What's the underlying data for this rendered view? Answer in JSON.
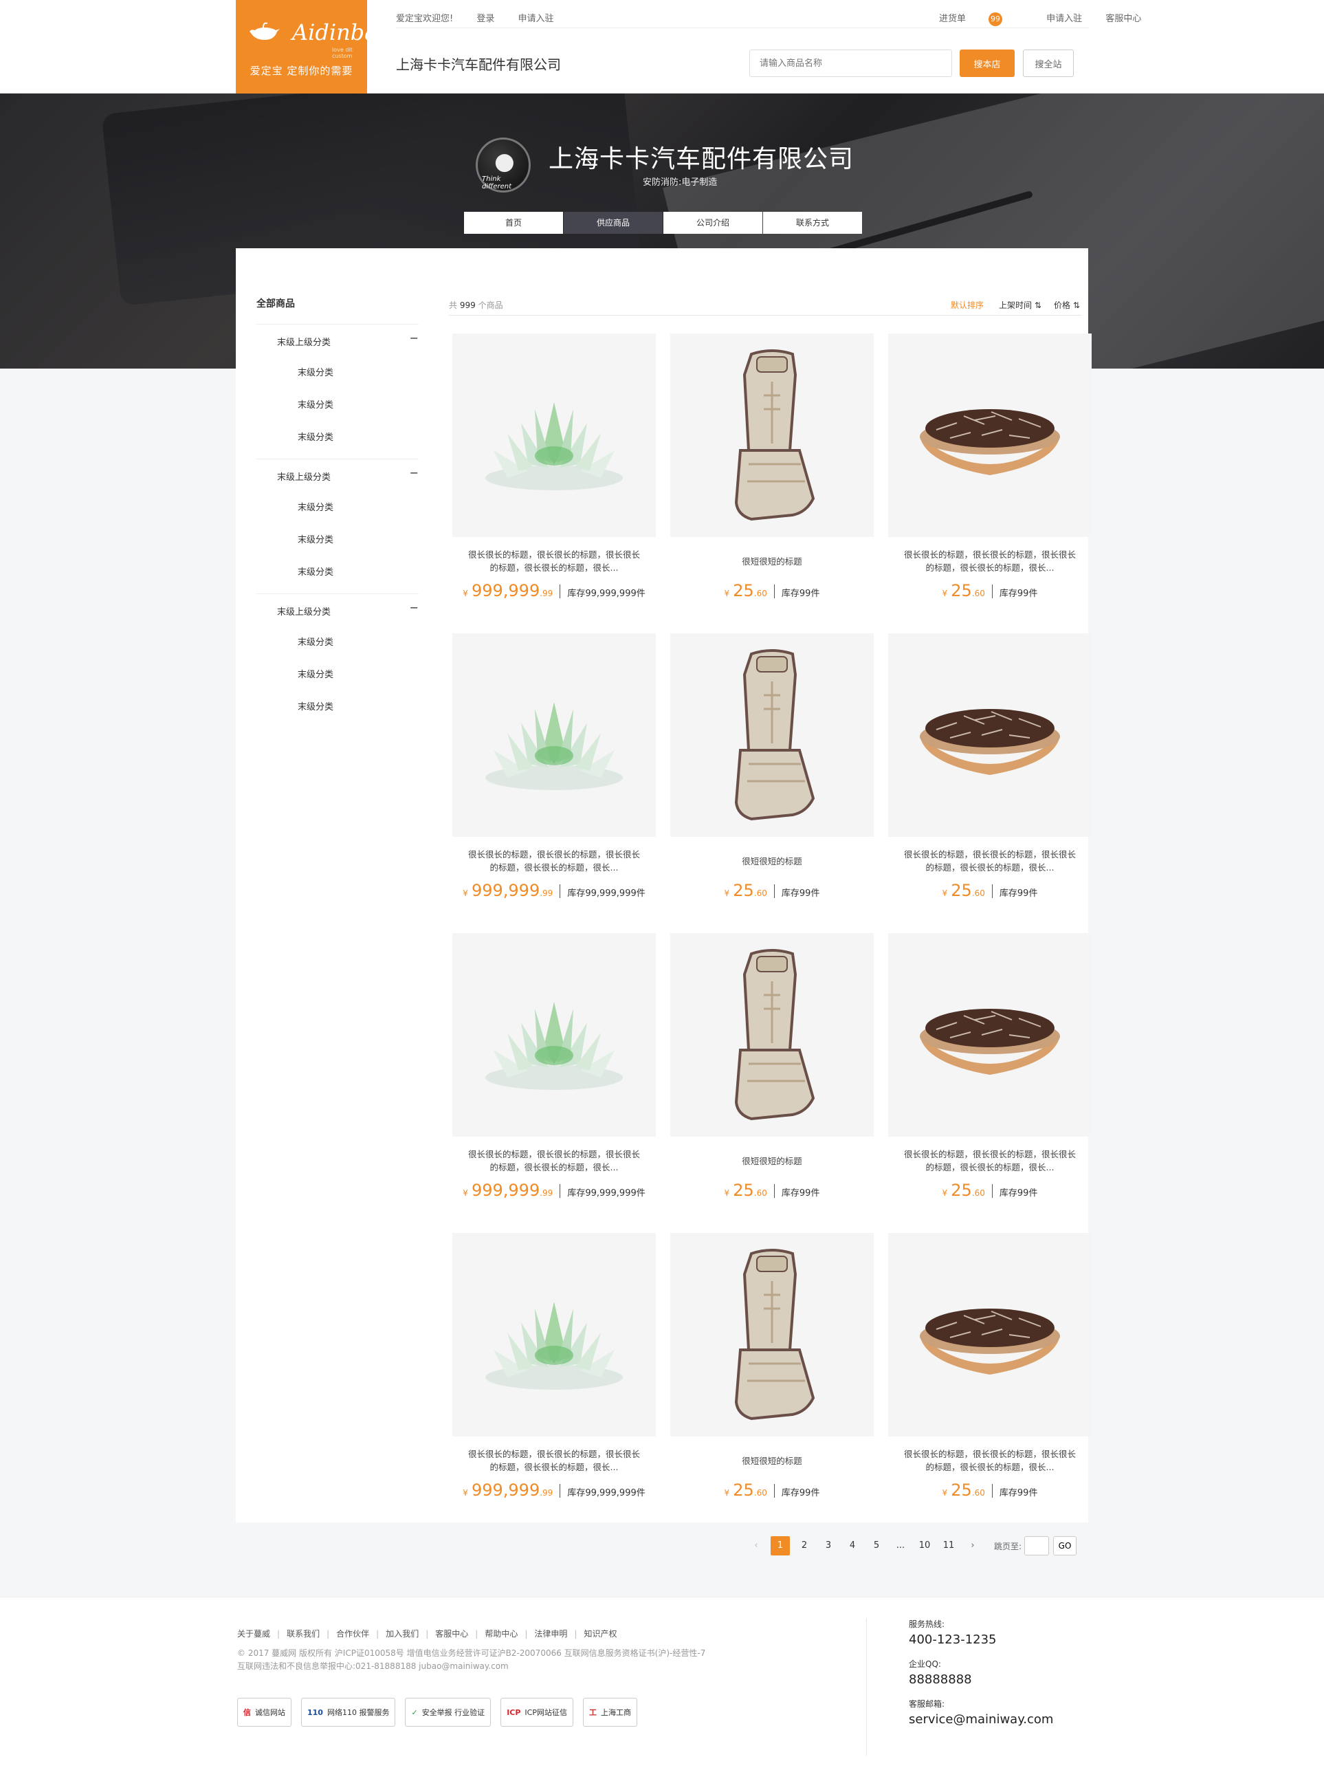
{
  "logo": {
    "brand": "Aidinbao",
    "tagline": "love dit custom",
    "slogan": "爱定宝 定制你的需要"
  },
  "topbar": {
    "welcome": "爱定宝欢迎您!",
    "login": "登录",
    "apply": "申请入驻",
    "cart_label": "进货单",
    "cart_count": "99",
    "apply_right": "申请入驻",
    "service": "客服中心"
  },
  "header": {
    "shop_name": "上海卡卡汽车配件有限公司",
    "search_placeholder": "请输入商品名称",
    "search_shop": "搜本店",
    "search_all": "搜全站"
  },
  "hero": {
    "title": "上海卡卡汽车配件有限公司",
    "subtitle": "安防消防:电子制造",
    "avatar_text": "Think different",
    "tabs": [
      {
        "label": "首页"
      },
      {
        "label": "供应商品"
      },
      {
        "label": "公司介绍"
      },
      {
        "label": "联系方式"
      }
    ],
    "active_tab": 1
  },
  "sidebar": {
    "title": "全部商品",
    "groups": [
      {
        "label": "末级上级分类",
        "toggle": "−",
        "leaves": [
          "末级分类",
          "末级分类",
          "末级分类"
        ]
      },
      {
        "label": "末级上级分类",
        "toggle": "−",
        "leaves": [
          "末级分类",
          "末级分类",
          "末级分类"
        ]
      },
      {
        "label": "末级上级分类",
        "toggle": "−",
        "leaves": [
          "末级分类",
          "末级分类",
          "末级分类"
        ]
      }
    ]
  },
  "toolbar": {
    "total_prefix": "共",
    "total_count": "999",
    "total_suffix": "个商品",
    "sort_default": "默认排序",
    "sort_time": "上架时间 ⇅",
    "sort_price": "价格 ⇅"
  },
  "products": [
    {
      "type": "lotus",
      "title": "很长很长的标题，很长很长的标题，很长很长的标题，很长很长的标题，很长...",
      "currency": "¥",
      "price_int": "999,999",
      "price_dec": ".99",
      "stock": "库存99,999,999件"
    },
    {
      "type": "seat",
      "title": "很短很短的标题",
      "currency": "¥",
      "price_int": "25",
      "price_dec": ".60",
      "stock": "库存99件"
    },
    {
      "type": "seeds",
      "title": "很长很长的标题，很长很长的标题，很长很长的标题，很长很长的标题，很长...",
      "currency": "¥",
      "price_int": "25",
      "price_dec": ".60",
      "stock": "库存99件"
    },
    {
      "type": "lotus",
      "title": "很长很长的标题，很长很长的标题，很长很长的标题，很长很长的标题，很长...",
      "currency": "¥",
      "price_int": "999,999",
      "price_dec": ".99",
      "stock": "库存99,999,999件"
    },
    {
      "type": "seat",
      "title": "很短很短的标题",
      "currency": "¥",
      "price_int": "25",
      "price_dec": ".60",
      "stock": "库存99件"
    },
    {
      "type": "seeds",
      "title": "很长很长的标题，很长很长的标题，很长很长的标题，很长很长的标题，很长...",
      "currency": "¥",
      "price_int": "25",
      "price_dec": ".60",
      "stock": "库存99件"
    },
    {
      "type": "lotus",
      "title": "很长很长的标题，很长很长的标题，很长很长的标题，很长很长的标题，很长...",
      "currency": "¥",
      "price_int": "999,999",
      "price_dec": ".99",
      "stock": "库存99,999,999件"
    },
    {
      "type": "seat",
      "title": "很短很短的标题",
      "currency": "¥",
      "price_int": "25",
      "price_dec": ".60",
      "stock": "库存99件"
    },
    {
      "type": "seeds",
      "title": "很长很长的标题，很长很长的标题，很长很长的标题，很长很长的标题，很长...",
      "currency": "¥",
      "price_int": "25",
      "price_dec": ".60",
      "stock": "库存99件"
    },
    {
      "type": "lotus",
      "title": "很长很长的标题，很长很长的标题，很长很长的标题，很长很长的标题，很长...",
      "currency": "¥",
      "price_int": "999,999",
      "price_dec": ".99",
      "stock": "库存99,999,999件"
    },
    {
      "type": "seat",
      "title": "很短很短的标题",
      "currency": "¥",
      "price_int": "25",
      "price_dec": ".60",
      "stock": "库存99件"
    },
    {
      "type": "seeds",
      "title": "很长很长的标题，很长很长的标题，很长很长的标题，很长很长的标题，很长...",
      "currency": "¥",
      "price_int": "25",
      "price_dec": ".60",
      "stock": "库存99件"
    }
  ],
  "pagination": {
    "prev": "‹",
    "pages": [
      "1",
      "2",
      "3",
      "4",
      "5",
      "...",
      "10",
      "11"
    ],
    "current": "1",
    "next": "›",
    "jump_label": "跳页至:",
    "go": "GO"
  },
  "footer": {
    "links": [
      "关于蔓威",
      "联系我们",
      "合作伙伴",
      "加入我们",
      "客服中心",
      "帮助中心",
      "法律申明",
      "知识产权"
    ],
    "copyright_1": "© 2017 蔓威网 版权所有  沪ICP证010058号   增值电信业务经营许可证沪B2-20070066    互联网信息服务资格证书(沪)-经营性-7",
    "copyright_2": "互联网违法和不良信息举报中心:021-81888188 jubao@mainiway.com",
    "badges": [
      {
        "icon": "信",
        "label": "诚信网站"
      },
      {
        "icon": "110",
        "label": "网络110 报警服务"
      },
      {
        "icon": "✓",
        "label": "安全举报 行业验证"
      },
      {
        "icon": "ICP",
        "label": "ICP网站征信"
      },
      {
        "icon": "工",
        "label": "上海工商"
      }
    ],
    "hotline_label": "服务热线:",
    "hotline": "400-123-1235",
    "qq_label": "企业QQ:",
    "qq": "88888888",
    "email_label": "客服邮箱:",
    "email": "service@mainiway.com"
  },
  "colors": {
    "accent": "#f18b26",
    "dark_tab": "#44454e"
  }
}
